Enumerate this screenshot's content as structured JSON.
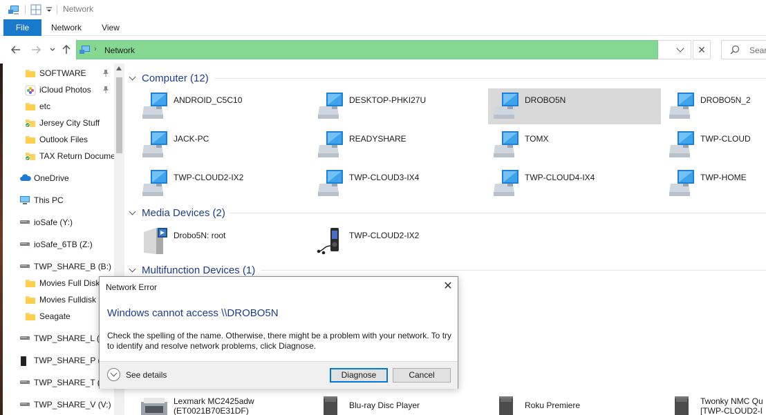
{
  "window": {
    "title": "Network"
  },
  "ribbon": {
    "tabs": [
      "File",
      "Network",
      "View"
    ]
  },
  "address": {
    "path": "Network",
    "search_placeholder": "Search"
  },
  "nav": {
    "items": [
      {
        "label": "SOFTWARE",
        "icon": "folder-icon",
        "pinned": true
      },
      {
        "label": "iCloud Photos",
        "icon": "icloud-photos-icon",
        "pinned": true
      },
      {
        "label": "etc",
        "icon": "folder-icon"
      },
      {
        "label": "Jersey City Stuff",
        "icon": "folder-synced-icon"
      },
      {
        "label": "Outlook Files",
        "icon": "folder-icon"
      },
      {
        "label": "TAX Return Docume",
        "icon": "folder-synced-icon"
      },
      {
        "label": "OneDrive",
        "icon": "onedrive-icon"
      },
      {
        "label": "This PC",
        "icon": "this-pc-icon"
      },
      {
        "label": "ioSafe (Y:)",
        "icon": "network-drive-icon"
      },
      {
        "label": "ioSafe_6TB (Z:)",
        "icon": "network-drive-icon"
      },
      {
        "label": "TWP_SHARE_B (B:)",
        "icon": "network-drive-icon"
      },
      {
        "label": "Movies Full Disk",
        "icon": "folder-icon"
      },
      {
        "label": "Movies Fulldisk",
        "icon": "folder-icon"
      },
      {
        "label": "Seagate",
        "icon": "folder-icon"
      },
      {
        "label": "TWP_SHARE_L (L:)",
        "icon": "network-drive-icon"
      },
      {
        "label": "TWP_SHARE_P (P:)",
        "icon": "usb-drive-icon"
      },
      {
        "label": "TWP_SHARE_T (T:)",
        "icon": "network-drive-icon"
      },
      {
        "label": "TWP_SHARE_V (V:)",
        "icon": "network-drive-icon"
      }
    ]
  },
  "groups": {
    "computer": {
      "title": "Computer (12)",
      "items": [
        "ANDROID_C5C10",
        "DESKTOP-PHKI27U",
        "DROBO5N",
        "DROBO5N_2",
        "JACK-PC",
        "READYSHARE",
        "TOMX",
        "TWP-CLOUD",
        "TWP-CLOUD2-IX2",
        "TWP-CLOUD3-IX4",
        "TWP-CLOUD4-IX4",
        "TWP-HOME"
      ],
      "selected": "DROBO5N"
    },
    "media": {
      "title": "Media Devices (2)",
      "items": [
        "Drobo5N: root",
        "TWP-CLOUD2-IX2"
      ]
    },
    "multifunction": {
      "title": "Multifunction Devices (1)"
    },
    "other_items": [
      {
        "line1": "Lexmark MC2425adw",
        "line2": "(ET0021B70E31DF)"
      },
      {
        "line1": "Blu-ray Disc Player"
      },
      {
        "line1": "Roku Premiere"
      },
      {
        "line1": "Twonky NMC Qu",
        "line2": "[TWP-CLOUD2-I"
      }
    ]
  },
  "dialog": {
    "title": "Network Error",
    "heading": "Windows cannot access \\\\DROBO5N",
    "body": "Check the spelling of the name. Otherwise, there might be a problem with your network. To try to identify and resolve network problems, click Diagnose.",
    "details_label": "See details",
    "diagnose_label": "Diagnose",
    "cancel_label": "Cancel"
  }
}
